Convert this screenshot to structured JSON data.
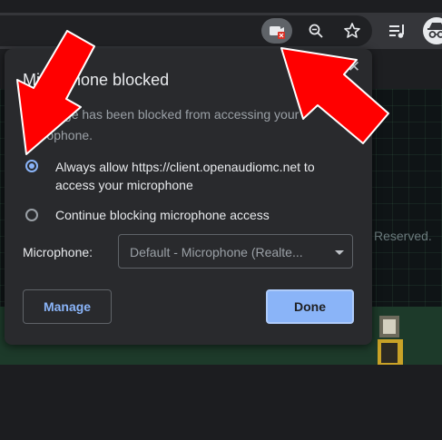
{
  "toolbar": {
    "icons": [
      "camera-blocked-icon",
      "zoom-icon",
      "bookmark-star-icon",
      "media-control-icon",
      "incognito-profile-icon"
    ]
  },
  "page": {
    "rights_text": "Reserved."
  },
  "popup": {
    "title": "Microphone blocked",
    "description": "This page has been blocked from accessing your microphone.",
    "options": [
      {
        "label": "Always allow https://client.openaudiomc.net to access your microphone",
        "selected": true
      },
      {
        "label": "Continue blocking microphone access",
        "selected": false
      }
    ],
    "microphone_label": "Microphone:",
    "microphone_value": "Default - Microphone (Realte...",
    "manage_label": "Manage",
    "done_label": "Done"
  },
  "colors": {
    "accent": "#8ab4f8",
    "annotation_red": "#ff0000",
    "popup_bg": "#292a2d"
  }
}
